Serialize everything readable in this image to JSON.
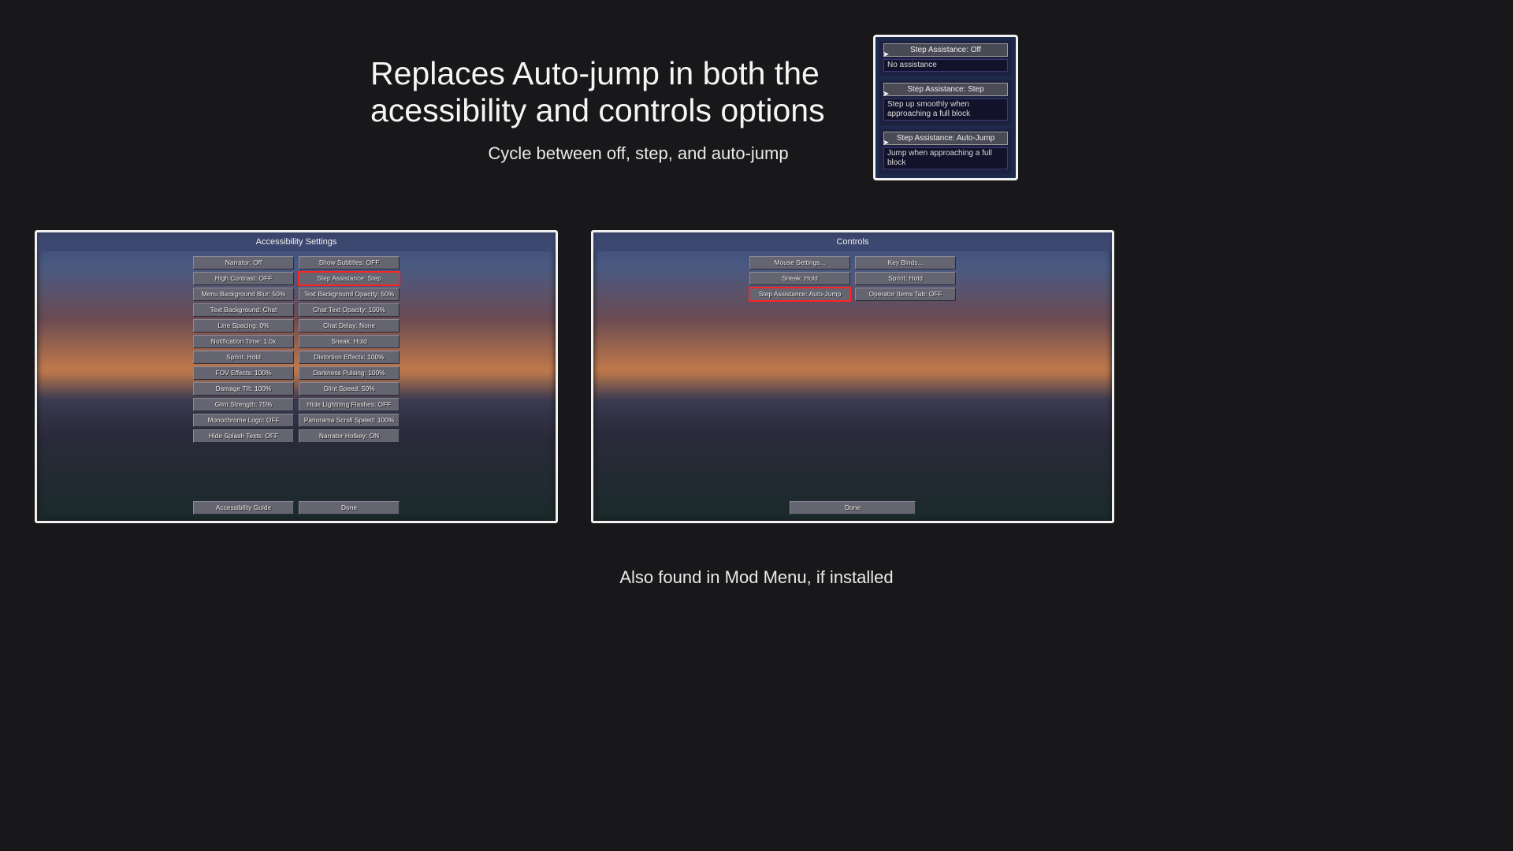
{
  "heading": "Replaces Auto-jump in both the acessibility and controls options",
  "subheading": "Cycle between off, step, and auto-jump",
  "footnote": "Also found in Mod Menu, if installed",
  "tooltips": [
    {
      "button": "Step Assistance: Off",
      "desc": "No assistance"
    },
    {
      "button": "Step Assistance: Step",
      "desc": "Step up smoothly when approaching a full block"
    },
    {
      "button": "Step Assistance: Auto-Jump",
      "desc": "Jump when approaching a full block"
    }
  ],
  "screenshot_a": {
    "title": "Accessibility Settings",
    "left_col": [
      "Narrator: Off",
      "High Contrast: OFF",
      "Menu Background Blur: 50%",
      "Text Background: Chat",
      "Line Spacing: 0%",
      "Notification Time: 1.0x",
      "Sprint: Hold",
      "FOV Effects: 100%",
      "Damage Tilt: 100%",
      "Glint Strength: 75%",
      "Monochrome Logo: OFF",
      "Hide Splash Texts: OFF"
    ],
    "right_col": [
      "Show Subtitles: OFF",
      "Step Assistance: Step",
      "Text Background Opacity: 50%",
      "Chat Text Opacity: 100%",
      "Chat Delay: None",
      "Sneak: Hold",
      "Distortion Effects: 100%",
      "Darkness Pulsing: 100%",
      "Glint Speed: 50%",
      "Hide Lightning Flashes: OFF",
      "Panorama Scroll Speed: 100%",
      "Narrator Hotkey: ON"
    ],
    "highlighted_index": 1,
    "bottom": [
      "Accessibility Guide",
      "Done"
    ]
  },
  "screenshot_b": {
    "title": "Controls",
    "left_col": [
      "Mouse Settings...",
      "Sneak: Hold",
      "Step Assistance: Auto-Jump"
    ],
    "right_col": [
      "Key Binds...",
      "Sprint: Hold",
      "Operator Items Tab: OFF"
    ],
    "highlighted_index": 2,
    "bottom": [
      "Done"
    ]
  }
}
